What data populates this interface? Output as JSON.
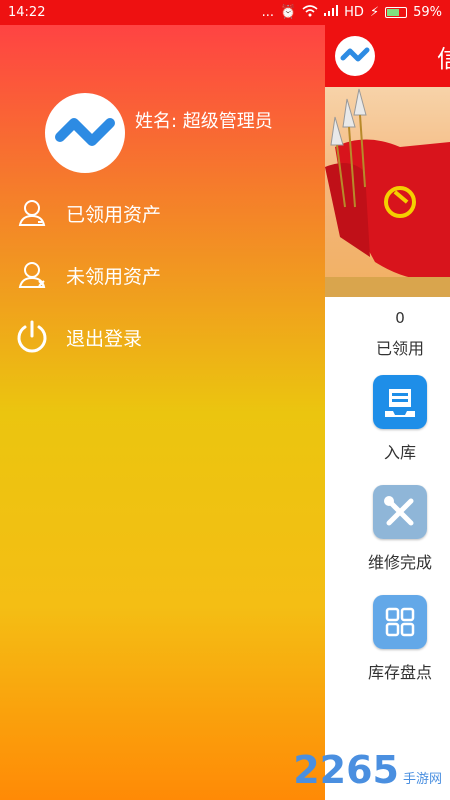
{
  "status_bar": {
    "time": "14:22",
    "dots": "...",
    "network": "HD",
    "battery": "59%"
  },
  "drawer": {
    "profile_name": "姓名: 超级管理员",
    "menu": [
      {
        "label": "已领用资产",
        "icon": "user-icon"
      },
      {
        "label": "未领用资产",
        "icon": "user-x-icon"
      },
      {
        "label": "退出登录",
        "icon": "power-icon"
      }
    ]
  },
  "main": {
    "header_title": "信",
    "count": "0",
    "count_label": "已领用",
    "functions": [
      {
        "label": "入库",
        "icon": "inbox-icon"
      },
      {
        "label": "维修完成",
        "icon": "repair-tools-icon"
      },
      {
        "label": "库存盘点",
        "icon": "grid-icon"
      }
    ]
  },
  "watermark": {
    "brand": "2265",
    "sub": "手游网"
  },
  "colors": {
    "header_red": "#ee1111",
    "drawer_top": "#ff4343",
    "drawer_mid": "#ebc50f",
    "drawer_bottom": "#ff8a06",
    "accent_blue": "#4a8fe0"
  }
}
